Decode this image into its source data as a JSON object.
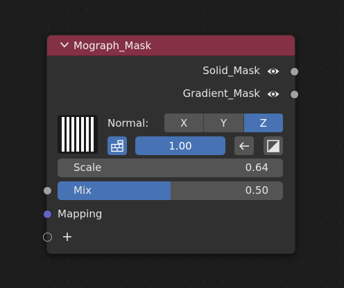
{
  "node": {
    "title": "Mograph_Mask",
    "header_color": "#843045",
    "outputs": [
      {
        "label": "Solid_Mask",
        "icon": "eye-icon"
      },
      {
        "label": "Gradient_Mask",
        "icon": "eye-icon"
      }
    ],
    "normal": {
      "label": "Normal:",
      "axes": [
        "X",
        "Y",
        "Z"
      ],
      "selected": "Z"
    },
    "value_field": "1.00",
    "scale": {
      "label": "Scale",
      "value": "0.64"
    },
    "mix": {
      "label": "Mix",
      "value": "0.50",
      "fraction": 0.5
    },
    "inputs": {
      "mapping": {
        "label": "Mapping",
        "socket_color": "#6363c7"
      }
    },
    "colors": {
      "accent": "#4772b3",
      "socket_grey": "#a1a1a1"
    }
  }
}
